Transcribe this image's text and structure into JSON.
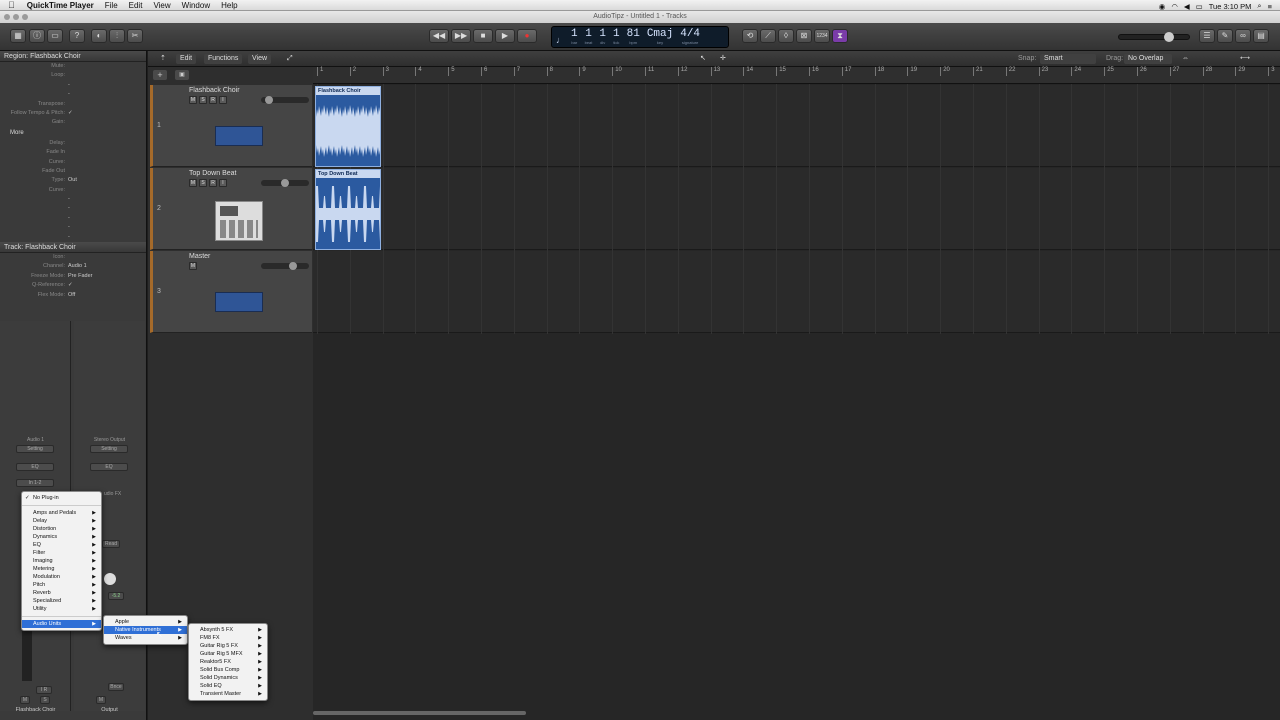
{
  "menubar": {
    "apple": "",
    "app": "QuickTime Player",
    "items": [
      "File",
      "Edit",
      "View",
      "Window",
      "Help"
    ],
    "clock": "Tue 3:10 PM"
  },
  "window": {
    "title": "AudioTipz - Untitled 1 - Tracks"
  },
  "lcd": {
    "bar": "1",
    "beat": "1",
    "div": "1",
    "tick": "1",
    "bpm": "81",
    "key": "Cmaj",
    "sig": "4/4",
    "labels": {
      "bar": "bar",
      "beat": "beat",
      "div": "div",
      "tick": "tick",
      "bpm": "bpm",
      "key": "key",
      "sig": "signature"
    }
  },
  "toolbar": {
    "count": "1234"
  },
  "inspector": {
    "region_header": "Region: Flashback Choir",
    "region_rows": [
      {
        "l": "Mute:",
        "v": ""
      },
      {
        "l": "Loop:",
        "v": ""
      },
      {
        "l": "",
        "v": "-"
      },
      {
        "l": "",
        "v": "-"
      },
      {
        "l": "Transpose:",
        "v": ""
      },
      {
        "l": "Follow Tempo & Pitch:",
        "v": "✓"
      },
      {
        "l": "Gain:",
        "v": ""
      }
    ],
    "more": "More",
    "more_rows": [
      {
        "l": "Delay:",
        "v": ""
      },
      {
        "l": "Fade In",
        "v": ""
      },
      {
        "l": "Curve:",
        "v": ""
      },
      {
        "l": "Fade Out",
        "v": ""
      },
      {
        "l": "Type:",
        "v": "Out"
      },
      {
        "l": "Curve:",
        "v": ""
      },
      {
        "l": "",
        "v": "-"
      },
      {
        "l": "",
        "v": "-"
      },
      {
        "l": "",
        "v": "-"
      },
      {
        "l": "",
        "v": "-"
      },
      {
        "l": "",
        "v": "-"
      }
    ],
    "track_header": "Track: Flashback Choir",
    "track_rows": [
      {
        "l": "Icon:",
        "v": ""
      },
      {
        "l": "Channel:",
        "v": "Audio 1"
      },
      {
        "l": "Freeze Mode:",
        "v": "Pre Fader"
      },
      {
        "l": "Q-Reference:",
        "v": "✓"
      },
      {
        "l": "Flex Mode:",
        "v": "Off"
      }
    ]
  },
  "channels": [
    {
      "name": "Audio 1",
      "setting": "Setting",
      "eq": "EQ",
      "input": "In 1-2",
      "bottom": "Flashback Choir",
      "mute": "M",
      "solo": "S",
      "ir": "I  R"
    },
    {
      "name": "Stereo Output",
      "setting": "Setting",
      "eq": "EQ",
      "fx": "udio FX",
      "read": "Read",
      "val": "-5.2",
      "bounce": "Bnce",
      "bottom": "Output",
      "mute": "M"
    }
  ],
  "trackbar": {
    "edit": "Edit",
    "functions": "Functions",
    "view": "View",
    "snap_label": "Snap:",
    "snap": "Smart",
    "drag_label": "Drag:",
    "drag": "No Overlap"
  },
  "ruler": [
    "1",
    "2",
    "3",
    "4",
    "5",
    "6",
    "7",
    "8",
    "9",
    "10",
    "11",
    "12",
    "13",
    "14",
    "15",
    "16",
    "17",
    "18",
    "19",
    "20",
    "21",
    "22",
    "23",
    "24",
    "25",
    "26",
    "27",
    "28",
    "29",
    "3"
  ],
  "tracks": [
    {
      "num": "1",
      "name": "Flashback Choir",
      "buttons": [
        "M",
        "S",
        "R",
        "I"
      ]
    },
    {
      "num": "2",
      "name": "Top Down Beat",
      "buttons": [
        "M",
        "S",
        "R",
        "I"
      ]
    },
    {
      "num": "3",
      "name": "Master",
      "buttons": [
        "M"
      ]
    }
  ],
  "regions": [
    {
      "name": "Flashback Choir"
    },
    {
      "name": "Top Down Beat"
    }
  ],
  "plugin_menu": {
    "top": "No Plug-in",
    "items": [
      "Amps and Pedals",
      "Delay",
      "Distortion",
      "Dynamics",
      "EQ",
      "Filter",
      "Imaging",
      "Metering",
      "Modulation",
      "Pitch",
      "Reverb",
      "Specialized",
      "Utility"
    ],
    "au": "Audio Units"
  },
  "au_menu": [
    "Apple",
    "Native Instruments",
    "Waves"
  ],
  "ni_menu": [
    "Absynth 5 FX",
    "FM8 FX",
    "Guitar Rig 5 FX",
    "Guitar Rig 5 MFX",
    "Reaktor5 FX",
    "Solid Bus Comp",
    "Solid Dynamics",
    "Solid EQ",
    "Transient Master"
  ]
}
